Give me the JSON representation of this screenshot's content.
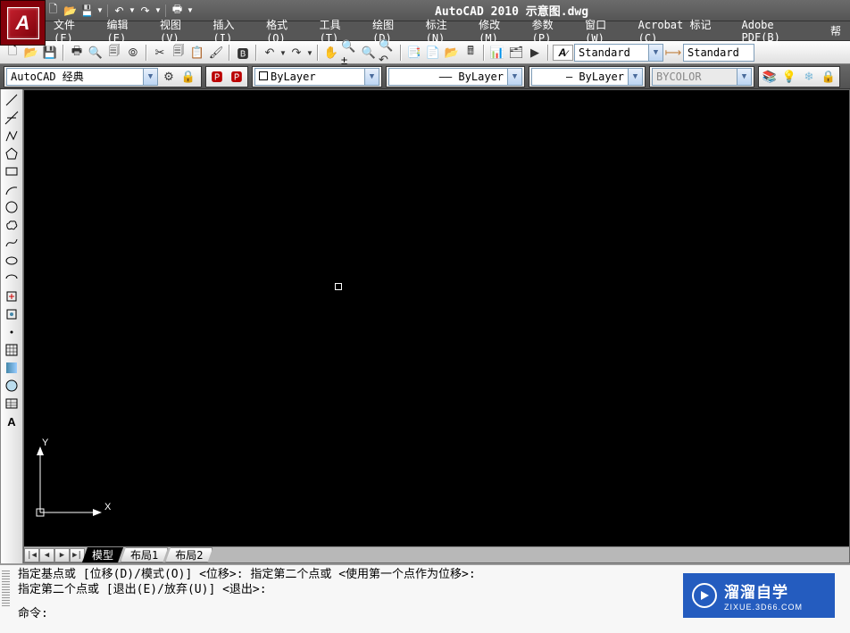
{
  "title": "AutoCAD 2010  示意图.dwg",
  "app_btn": "A",
  "qat_icons": [
    "new-icon",
    "open-icon",
    "save-icon",
    "dropdown-icon",
    "undo-icon",
    "dropdown-icon",
    "redo-icon",
    "dropdown-icon",
    "print-icon",
    "dropdown-icon"
  ],
  "menus": [
    "文件(F)",
    "编辑(E)",
    "视图(V)",
    "插入(I)",
    "格式(O)",
    "工具(T)",
    "绘图(D)",
    "标注(N)",
    "修改(M)",
    "参数(P)",
    "窗口(W)",
    "Acrobat 标记(C)",
    "Adobe PDF(B)",
    "帮"
  ],
  "workspace": {
    "label": "AutoCAD 经典"
  },
  "text_style": {
    "a": "Standard",
    "b": "Standard"
  },
  "layer_combo": "ByLayer",
  "linetype_combo": "ByLayer",
  "lineweight_combo": "ByLayer",
  "plotstyle_combo": "BYCOLOR",
  "tabs": {
    "nav": [
      "|◀",
      "◀",
      "▶",
      "▶|"
    ],
    "model": "模型",
    "layout1": "布局1",
    "layout2": "布局2"
  },
  "ucs": {
    "x": "X",
    "y": "Y"
  },
  "cmd": {
    "line1": "指定基点或 [位移(D)/模式(O)] <位移>: 指定第二个点或 <使用第一个点作为位移>:",
    "line2": "指定第二个点或 [退出(E)/放弃(U)] <退出>:",
    "prompt": "命令:"
  },
  "watermark": {
    "brand": "溜溜自学",
    "url": "ZIXUE.3D66.COM"
  }
}
